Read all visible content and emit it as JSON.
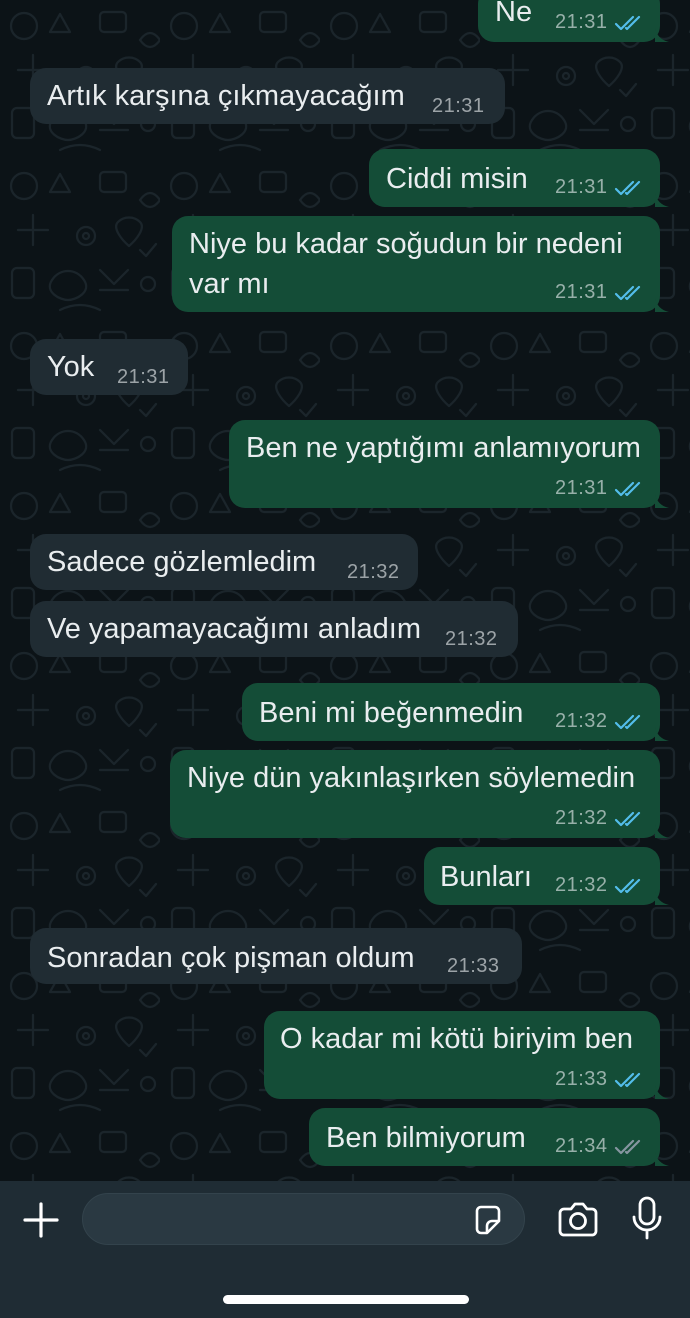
{
  "colors": {
    "incoming_bubble": "#202c33",
    "outgoing_bubble": "#144d37",
    "read_ticks": "#53bdeb",
    "delivered_ticks": "#8696a0",
    "background": "#0b141a"
  },
  "messages": [
    {
      "direction": "out",
      "text": "Ne",
      "time": "21:31",
      "status": "read"
    },
    {
      "direction": "in",
      "text": "Artık karşına çıkmayacağım",
      "time": "21:31"
    },
    {
      "direction": "out",
      "text": "Ciddi misin",
      "time": "21:31",
      "status": "read"
    },
    {
      "direction": "out",
      "text": "Niye bu kadar soğudun bir nedeni var mı",
      "time": "21:31",
      "status": "read"
    },
    {
      "direction": "in",
      "text": "Yok",
      "time": "21:31"
    },
    {
      "direction": "out",
      "text": "Ben ne yaptığımı anlamıyorum",
      "time": "21:31",
      "status": "read"
    },
    {
      "direction": "in",
      "text": "Sadece gözlemledim",
      "time": "21:32"
    },
    {
      "direction": "in",
      "text": "Ve yapamayacağımı anladım",
      "time": "21:32"
    },
    {
      "direction": "out",
      "text": "Beni mi beğenmedin",
      "time": "21:32",
      "status": "read"
    },
    {
      "direction": "out",
      "text": "Niye dün yakınlaşırken söylemedin",
      "time": "21:32",
      "status": "read"
    },
    {
      "direction": "out",
      "text": "Bunları",
      "time": "21:32",
      "status": "read"
    },
    {
      "direction": "in",
      "text": "Sonradan çok pişman oldum",
      "time": "21:33"
    },
    {
      "direction": "out",
      "text": "O kadar mi kötü biriyim ben",
      "time": "21:33",
      "status": "read"
    },
    {
      "direction": "out",
      "text": "Ben bilmiyorum",
      "time": "21:34",
      "status": "delivered"
    }
  ],
  "composer": {
    "input_value": "",
    "icons": [
      "plus-icon",
      "sticker-icon",
      "camera-icon",
      "microphone-icon"
    ]
  }
}
